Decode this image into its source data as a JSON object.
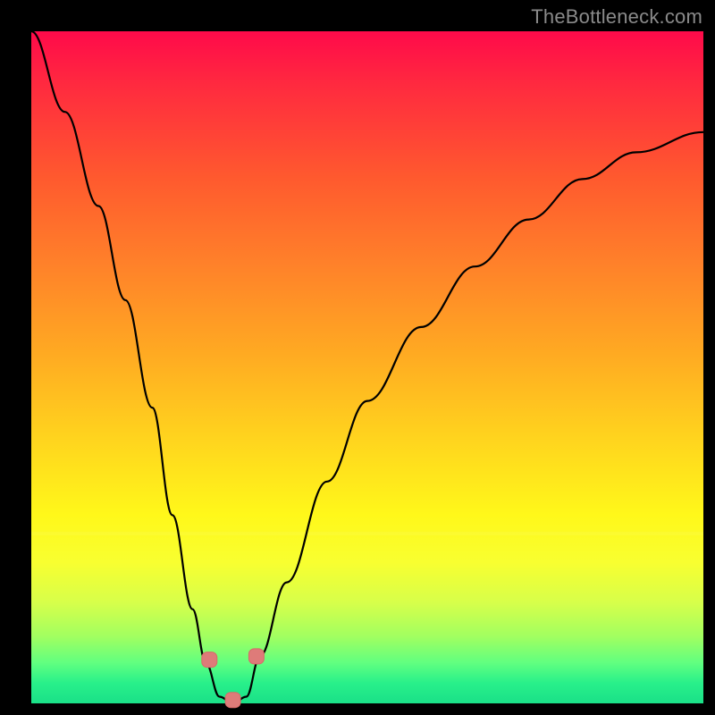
{
  "watermark": "TheBottleneck.com",
  "chart_data": {
    "type": "line",
    "title": "",
    "xlabel": "",
    "ylabel": "",
    "xlim": [
      0,
      100
    ],
    "ylim": [
      0,
      100
    ],
    "grid": false,
    "legend": false,
    "background_gradient": {
      "top": "#ff0a4a",
      "bottom": "#1ae088",
      "description": "red at top through orange/yellow to green at bottom"
    },
    "series": [
      {
        "name": "bottleneck-curve",
        "x": [
          0,
          5,
          10,
          14,
          18,
          21,
          24,
          26,
          28,
          30,
          32,
          34,
          38,
          44,
          50,
          58,
          66,
          74,
          82,
          90,
          100
        ],
        "y": [
          100,
          88,
          74,
          60,
          44,
          28,
          14,
          6,
          1,
          0,
          1,
          7,
          18,
          33,
          45,
          56,
          65,
          72,
          78,
          82,
          85
        ]
      }
    ],
    "markers": [
      {
        "name": "left-marker",
        "x": 26.5,
        "y": 6.5
      },
      {
        "name": "bottom-marker",
        "x": 30.0,
        "y": 0.5
      },
      {
        "name": "right-marker",
        "x": 33.5,
        "y": 7.0
      }
    ]
  }
}
